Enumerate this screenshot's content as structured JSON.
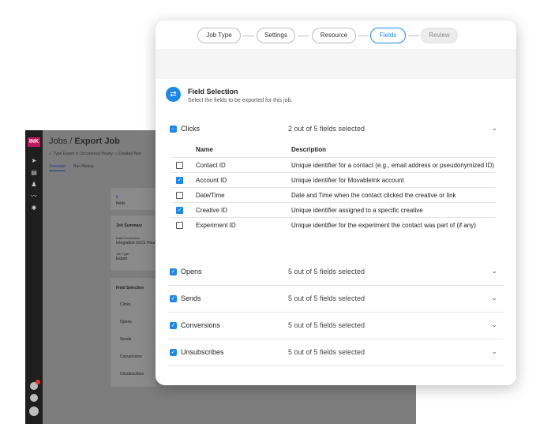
{
  "background_app": {
    "logo": "INK",
    "breadcrumb_parent": "Jobs",
    "breadcrumb_sep": " / ",
    "title": "Export Job",
    "meta": "⇩ Type Export   ↻ Occurrence Hourly   ▭ Created Nov",
    "tabs": [
      "Overview",
      "Run History"
    ],
    "stat_value": "5",
    "stat_label": "fields",
    "summary_title": "Job Summary",
    "summary_connection_label": "Data Connection",
    "summary_connection_value": "Integration (GCS Hourly)",
    "summary_job_label": "Job Type",
    "summary_job_value": "Export",
    "field_selection_title": "Field Selection",
    "field_selection_items": [
      "Clicks",
      "Opens",
      "Sends",
      "Conversions",
      "Unsubscribes"
    ]
  },
  "stepper": {
    "steps": [
      {
        "label": "Job Type",
        "state": "done"
      },
      {
        "label": "Settings",
        "state": "done"
      },
      {
        "label": "Resource",
        "state": "done"
      },
      {
        "label": "Fields",
        "state": "active"
      },
      {
        "label": "Review",
        "state": "disabled"
      }
    ]
  },
  "field_selection": {
    "icon": "swap-arrows-icon",
    "title": "Field Selection",
    "subtitle": "Select the fields to be exported for this job."
  },
  "sections": [
    {
      "name": "Clicks",
      "count": "2 out of 5 fields selected",
      "state": "indeterminate",
      "expanded": true
    },
    {
      "name": "Opens",
      "count": "5 out of 5 fields selected",
      "state": "checked",
      "expanded": false
    },
    {
      "name": "Sends",
      "count": "5 out of 5 fields selected",
      "state": "checked",
      "expanded": false
    },
    {
      "name": "Conversions",
      "count": "5 out of 5 fields selected",
      "state": "checked",
      "expanded": false
    },
    {
      "name": "Unsubscribes",
      "count": "5 out of 5 fields selected",
      "state": "checked",
      "expanded": false
    }
  ],
  "clicks_table": {
    "headers": {
      "name": "Name",
      "description": "Description"
    },
    "rows": [
      {
        "name": "Contact ID",
        "description": "Unique identifier for a contact (e.g., email address or pseudonymized ID)",
        "checked": false
      },
      {
        "name": "Account ID",
        "description": "Unique identifier for MovableInk account",
        "checked": true
      },
      {
        "name": "Date/Time",
        "description": "Date and Time when the contact clicked the creative or link",
        "checked": false
      },
      {
        "name": "Creative ID",
        "description": "Unique identifier assigned to a specific creative",
        "checked": true
      },
      {
        "name": "Experiment ID",
        "description": "Unique identifier for the experiment the contact was part of (if any)",
        "checked": false
      }
    ]
  },
  "colors": {
    "accent": "#1e88e5",
    "rail": "#1f1f1f",
    "logo": "#c2185b"
  }
}
